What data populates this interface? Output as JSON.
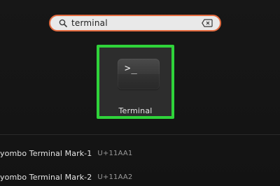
{
  "search": {
    "value": "terminal"
  },
  "icons": {
    "search": "search-icon",
    "clear": "backspace-clear-icon",
    "app": "terminal-app-icon"
  },
  "app_tile": {
    "prompt_glyph": ">_",
    "label": "Terminal",
    "highlight_color": "#2fd33a"
  },
  "results": [
    {
      "name": "yombo Terminal Mark-1",
      "code": "U+11AA1"
    },
    {
      "name": "yombo Terminal Mark-2",
      "code": "U+11AA2"
    }
  ],
  "colors": {
    "search_border": "#e46b3f",
    "background": "#161616"
  }
}
